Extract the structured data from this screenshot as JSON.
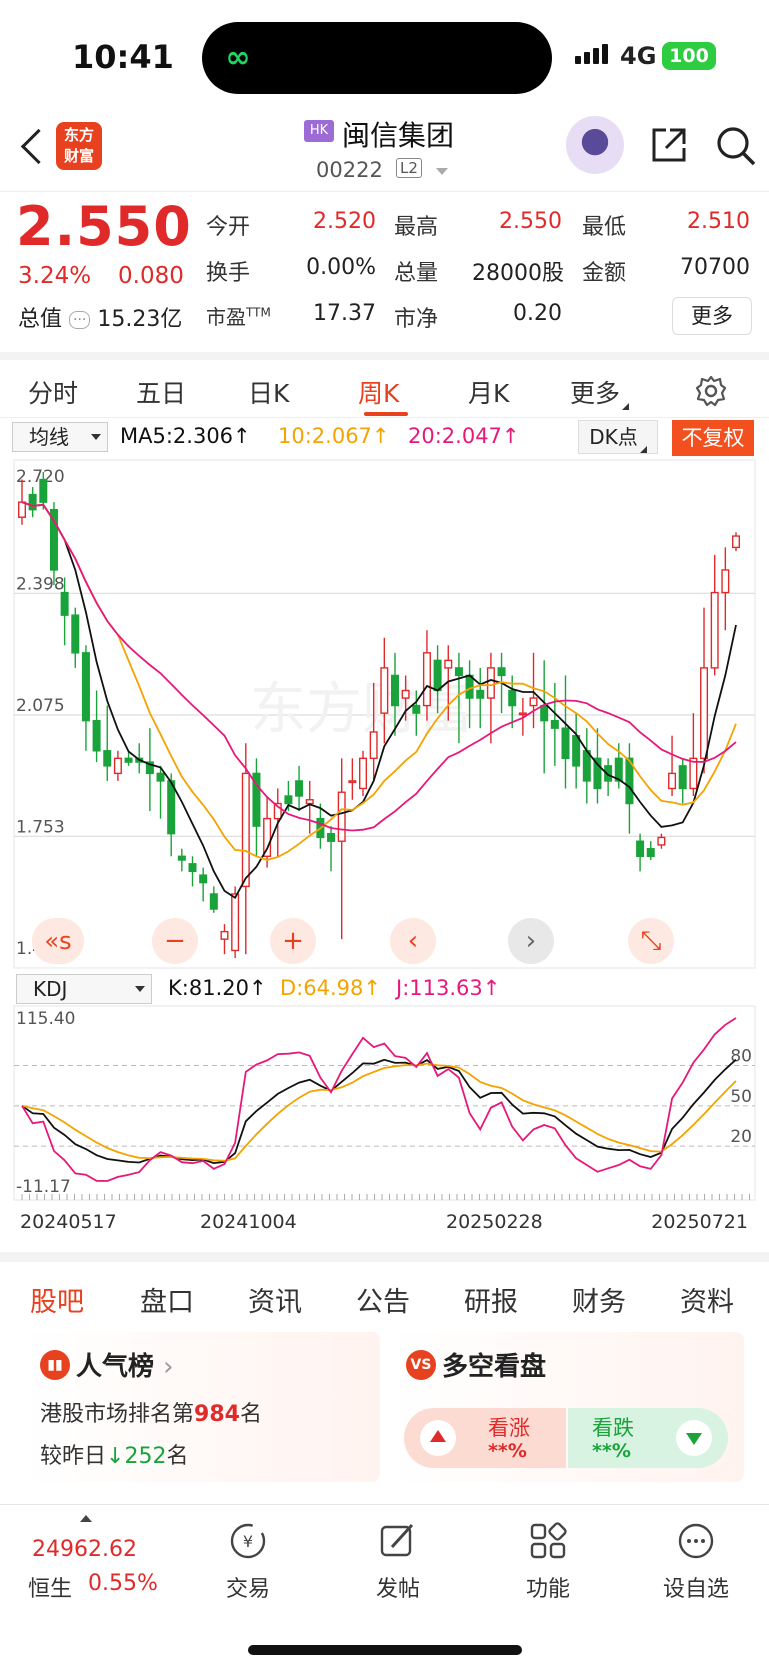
{
  "status_bar": {
    "time": "10:41",
    "network": "4G",
    "battery": "100"
  },
  "header": {
    "logo_line1": "东方",
    "logo_line2": "财富",
    "market_badge": "HK",
    "stock_name": "闽信集团",
    "stock_code": "00222",
    "level_badge": "L2"
  },
  "quote": {
    "price": "2.550",
    "change_pct": "3.24%",
    "change_val": "0.080",
    "open_label": "今开",
    "open": "2.520",
    "high_label": "最高",
    "high": "2.550",
    "low_label": "最低",
    "low": "2.510",
    "turnover_label": "换手",
    "turnover": "0.00%",
    "volume_label": "总量",
    "volume": "28000股",
    "amount_label": "金额",
    "amount": "70700",
    "mcap_label": "总值",
    "mcap": "15.23亿",
    "pe_label": "市盈",
    "pe_sup": "TTM",
    "pe": "17.37",
    "pb_label": "市净",
    "pb": "0.20",
    "more_label": "更多"
  },
  "period_tabs": [
    "分时",
    "五日",
    "日K",
    "周K",
    "月K",
    "更多"
  ],
  "active_period": "周K",
  "ma_bar": {
    "selector": "均线",
    "ma5": "MA5:2.306↑",
    "ma10": "10:2.067↑",
    "ma20": "20:2.047↑",
    "dk_label": "DK点",
    "adjust_label": "不复权"
  },
  "kdj_bar": {
    "selector": "KDJ",
    "k": "K:81.20↑",
    "d": "D:64.98↑",
    "j": "J:113.63↑"
  },
  "colors": {
    "up": "#e02a2a",
    "down": "#1aa33a",
    "ma5": "#111111",
    "ma10": "#f4a300",
    "ma20": "#e6197b",
    "accent": "#e8411f"
  },
  "chart_data": [
    {
      "type": "candlestick",
      "title": "",
      "y_ticks": [
        "2.720",
        "2.398",
        "2.075",
        "1.753",
        "1.430"
      ],
      "ylim": [
        1.43,
        2.72
      ],
      "x_ticks": [
        "20240517",
        "20241004",
        "20250228",
        "20250721"
      ],
      "candles": [
        [
          2.6,
          2.64,
          2.7,
          2.58
        ],
        [
          2.66,
          2.62,
          2.68,
          2.6
        ],
        [
          2.7,
          2.64,
          2.72,
          2.62
        ],
        [
          2.62,
          2.46,
          2.64,
          2.42
        ],
        [
          2.4,
          2.34,
          2.44,
          2.26
        ],
        [
          2.34,
          2.24,
          2.36,
          2.2
        ],
        [
          2.24,
          2.06,
          2.26,
          1.98
        ],
        [
          2.06,
          1.98,
          2.14,
          1.95
        ],
        [
          1.98,
          1.94,
          2.1,
          1.9
        ],
        [
          1.92,
          1.96,
          1.98,
          1.9
        ],
        [
          1.96,
          1.95,
          1.98,
          1.94
        ],
        [
          1.96,
          1.95,
          2.0,
          1.92
        ],
        [
          1.95,
          1.92,
          2.04,
          1.82
        ],
        [
          1.92,
          1.9,
          1.94,
          1.8
        ],
        [
          1.9,
          1.76,
          1.92,
          1.7
        ],
        [
          1.7,
          1.69,
          1.72,
          1.66
        ],
        [
          1.68,
          1.66,
          1.7,
          1.62
        ],
        [
          1.65,
          1.63,
          1.67,
          1.58
        ],
        [
          1.6,
          1.56,
          1.62,
          1.55
        ],
        [
          1.48,
          1.5,
          1.52,
          1.44
        ],
        [
          1.45,
          1.6,
          1.62,
          1.43
        ],
        [
          1.62,
          1.92,
          2.0,
          1.44
        ],
        [
          1.92,
          1.78,
          1.96,
          1.7
        ],
        [
          1.7,
          1.8,
          1.86,
          1.67
        ],
        [
          1.8,
          1.84,
          1.88,
          1.7
        ],
        [
          1.86,
          1.84,
          1.9,
          1.82
        ],
        [
          1.9,
          1.86,
          1.94,
          1.82
        ],
        [
          1.84,
          1.85,
          1.9,
          1.76
        ],
        [
          1.8,
          1.75,
          1.84,
          1.72
        ],
        [
          1.76,
          1.74,
          1.78,
          1.66
        ],
        [
          1.74,
          1.87,
          1.96,
          1.48
        ],
        [
          1.9,
          1.9,
          1.96,
          1.85
        ],
        [
          1.88,
          1.96,
          1.98,
          1.86
        ],
        [
          1.96,
          2.03,
          2.16,
          1.9
        ],
        [
          2.08,
          2.2,
          2.28,
          2.0
        ],
        [
          2.18,
          2.1,
          2.24,
          2.02
        ],
        [
          2.12,
          2.14,
          2.18,
          2.06
        ],
        [
          2.1,
          2.08,
          2.14,
          2.02
        ],
        [
          2.1,
          2.24,
          2.3,
          2.06
        ],
        [
          2.22,
          2.14,
          2.26,
          2.08
        ],
        [
          2.2,
          2.22,
          2.26,
          2.06
        ],
        [
          2.2,
          2.18,
          2.24,
          2.0
        ],
        [
          2.18,
          2.12,
          2.22,
          2.04
        ],
        [
          2.14,
          2.12,
          2.2,
          2.04
        ],
        [
          2.12,
          2.2,
          2.24,
          2.0
        ],
        [
          2.2,
          2.18,
          2.24,
          2.08
        ],
        [
          2.14,
          2.1,
          2.18,
          2.04
        ],
        [
          2.08,
          2.08,
          2.12,
          2.02
        ],
        [
          2.1,
          2.12,
          2.24,
          2.04
        ],
        [
          2.1,
          2.06,
          2.22,
          1.92
        ],
        [
          2.06,
          2.04,
          2.16,
          1.94
        ],
        [
          2.04,
          1.96,
          2.18,
          1.88
        ],
        [
          2.02,
          1.94,
          2.08,
          1.88
        ],
        [
          1.98,
          1.9,
          2.04,
          1.84
        ],
        [
          1.96,
          1.88,
          2.04,
          1.84
        ],
        [
          1.94,
          1.9,
          1.96,
          1.86
        ],
        [
          1.96,
          1.9,
          2.0,
          1.88
        ],
        [
          1.96,
          1.84,
          2.0,
          1.76
        ],
        [
          1.74,
          1.7,
          1.76,
          1.66
        ],
        [
          1.72,
          1.7,
          1.74,
          1.69
        ],
        [
          1.73,
          1.75,
          1.76,
          1.72
        ],
        [
          1.88,
          1.92,
          2.02,
          1.86
        ],
        [
          1.94,
          1.88,
          1.96,
          1.84
        ],
        [
          1.88,
          1.96,
          2.08,
          1.86
        ],
        [
          1.96,
          2.2,
          2.36,
          1.92
        ],
        [
          2.2,
          2.4,
          2.5,
          2.18
        ],
        [
          2.4,
          2.46,
          2.52,
          2.3
        ],
        [
          2.52,
          2.55,
          2.56,
          2.51
        ]
      ],
      "ma5_label": "MA5",
      "ma10_label": "10",
      "ma20_label": "20"
    },
    {
      "type": "line",
      "title": "",
      "y_ticks": [
        "115.40",
        "-11.17"
      ],
      "y_ref_labels": [
        "80",
        "50",
        "20"
      ],
      "ylim": [
        -11.17,
        115.4
      ]
    }
  ],
  "chart_controls": [
    "«s",
    "−",
    "+",
    "‹",
    "›",
    "⤡"
  ],
  "bottom_tabs": [
    "股吧",
    "盘口",
    "资讯",
    "公告",
    "研报",
    "财务",
    "资料"
  ],
  "active_bottom_tab": "股吧",
  "popularity_card": {
    "title": "人气榜",
    "line1_prefix": "港股市场排名第",
    "rank": "984",
    "line1_suffix": "名",
    "line2_prefix": "较昨日",
    "delta": "252",
    "line2_suffix": "名"
  },
  "sentiment_card": {
    "title": "多空看盘",
    "icon_text": "VS",
    "rise_label": "看涨",
    "rise_value": "**%",
    "fall_label": "看跌",
    "fall_value": "**%"
  },
  "footer": {
    "index_value": "24962.62",
    "index_name": "恒生",
    "index_change": "0.55%",
    "items": [
      "交易",
      "发帖",
      "功能",
      "设自选"
    ]
  }
}
